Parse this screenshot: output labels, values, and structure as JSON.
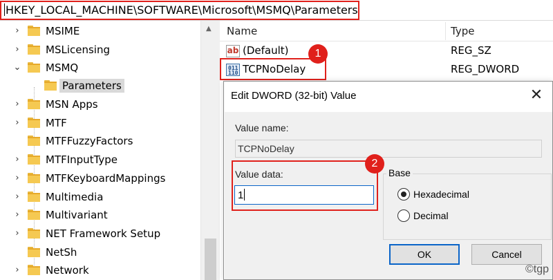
{
  "address_bar": {
    "path": "HKEY_LOCAL_MACHINE\\SOFTWARE\\Microsoft\\MSMQ\\Parameters"
  },
  "tree": {
    "items": [
      {
        "label": "MSIME",
        "expanded": false
      },
      {
        "label": "MSLicensing",
        "expanded": false
      },
      {
        "label": "MSMQ",
        "expanded": true
      },
      {
        "label": "Parameters",
        "selected": true,
        "child": true
      },
      {
        "label": "MSN Apps",
        "expanded": false
      },
      {
        "label": "MTF",
        "expanded": false
      },
      {
        "label": "MTFFuzzyFactors",
        "leaf": true
      },
      {
        "label": "MTFInputType",
        "expanded": false
      },
      {
        "label": "MTFKeyboardMappings",
        "expanded": false
      },
      {
        "label": "Multimedia",
        "expanded": false
      },
      {
        "label": "Multivariant",
        "expanded": false
      },
      {
        "label": "NET Framework Setup",
        "expanded": false
      },
      {
        "label": "NetSh",
        "leaf": true
      },
      {
        "label": "Network",
        "expanded": false
      }
    ]
  },
  "list": {
    "columns": {
      "name": "Name",
      "type": "Type"
    },
    "rows": [
      {
        "name": "(Default)",
        "type": "REG_SZ",
        "icon": "string-value-icon"
      },
      {
        "name": "TCPNoDelay",
        "type": "REG_DWORD",
        "icon": "binary-value-icon"
      }
    ]
  },
  "badges": {
    "one": "1",
    "two": "2"
  },
  "dialog": {
    "title": "Edit DWORD (32-bit) Value",
    "close": "✕",
    "value_name_label": "Value name:",
    "value_name": "TCPNoDelay",
    "value_data_label": "Value data:",
    "value_data": "1",
    "base_label": "Base",
    "base_options": [
      {
        "label": "Hexadecimal",
        "selected": true
      },
      {
        "label": "Decimal",
        "selected": false
      }
    ],
    "ok_label": "OK",
    "cancel_label": "Cancel"
  },
  "watermark": "©tgp",
  "colors": {
    "highlight": "#e0201b",
    "folder": "#f5c952",
    "focus": "#0a64c8"
  }
}
